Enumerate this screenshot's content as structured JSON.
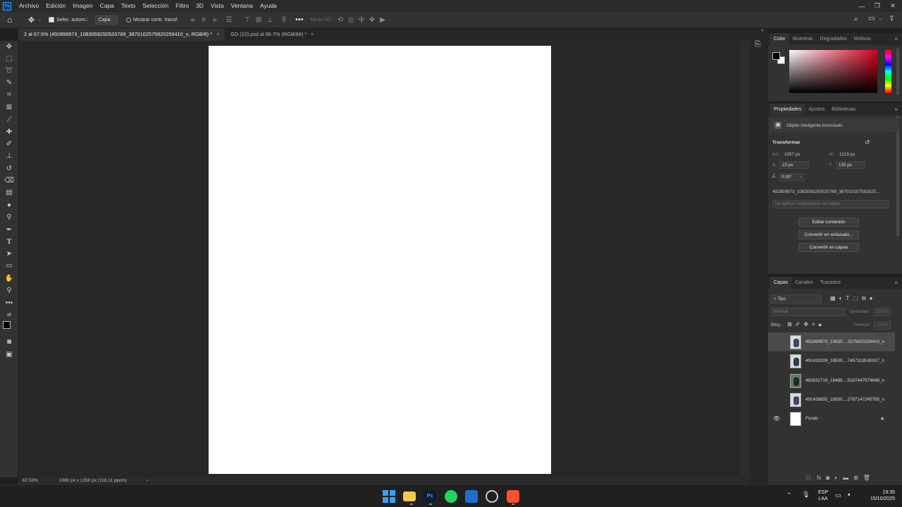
{
  "menubar": {
    "app_icon": "Ps",
    "items": [
      "Archivo",
      "Edición",
      "Imagen",
      "Capa",
      "Texto",
      "Selección",
      "Filtro",
      "3D",
      "Vista",
      "Ventana",
      "Ayuda"
    ]
  },
  "options_bar": {
    "auto_select_label": "Selec. autom.:",
    "auto_select_value": "Capa",
    "show_transform_label": "Mostrar contr. transf.",
    "mode_3d_label": "Modo 3D:"
  },
  "tabs": [
    {
      "label": "2 al 67.5% (492899973_1083059250520789_3870102575820259410_n, RGB/8) *",
      "close": "×"
    },
    {
      "label": "GD (10).psd al 66.7% (RGB/8#) *",
      "close": "×"
    }
  ],
  "status": {
    "zoom": "67.53%",
    "doc_info": "1080 px x 1350 px (118.11 ppcm)",
    "arrow": "›"
  },
  "color_panel": {
    "tabs": [
      "Color",
      "Muestras",
      "Degradados",
      "Motivos"
    ],
    "accent": "#c8102e"
  },
  "properties_panel": {
    "tabs": [
      "Propiedades",
      "Ajustes",
      "Bibliotecas"
    ],
    "object_type": "Objeto inteligente incrustado",
    "transform_title": "Transformar",
    "width_label": "An.:",
    "width_value": "1057 px",
    "height_label": "Al.:",
    "height_value": "1215 px",
    "x_label": "X:",
    "x_value": "23 px",
    "y_label": "Y:",
    "y_value": "135 px",
    "angle_value": "0.00°",
    "file_name": "492899973_1083059250520789_387010257582025...",
    "comp_placeholder": "No aplicar composición de capas",
    "buttons": [
      "Editar contenido",
      "Convertir en enlazado...",
      "Convertir en capas"
    ]
  },
  "layers_panel": {
    "tabs": [
      "Capas",
      "Canales",
      "Trazados"
    ],
    "filter_label": "Tipo",
    "blend_mode": "Normal",
    "opacity_label": "Opacidad:",
    "opacity_value": "100%",
    "lock_label": "Bloq.:",
    "fill_label": "Relleno:",
    "fill_value": "100%",
    "layers": [
      {
        "name": "492899973_10830....2575820259410_n",
        "visible": false,
        "selected": true
      },
      {
        "name": "491433209_18500....7457318530027_n",
        "visible": false,
        "selected": false
      },
      {
        "name": "482632718_18489....5167447574648_n",
        "visible": false,
        "selected": false
      },
      {
        "name": "491439855_18500....2787147245785_n",
        "visible": false,
        "selected": false
      },
      {
        "name": "Fondo",
        "visible": true,
        "selected": false,
        "locked": true
      }
    ]
  },
  "taskbar": {
    "lang_top": "ESP",
    "lang_bottom": "LAA",
    "time": "19:35",
    "date": "15/10/2025"
  }
}
